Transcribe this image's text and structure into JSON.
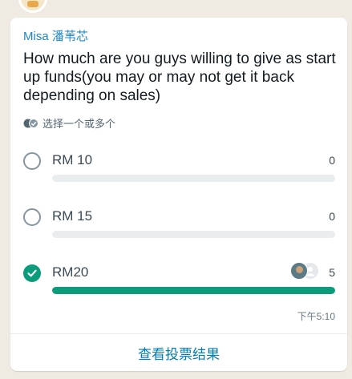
{
  "message": {
    "sender": "Misa 潘苇芯",
    "poll": {
      "question": "How much are you guys willing to give as start up funds(you may or may not get it back depending on sales)",
      "hint": "选择一个或多个",
      "options": [
        {
          "label": "RM 10",
          "votes": "0",
          "fraction": 0,
          "selected": false
        },
        {
          "label": "RM 15",
          "votes": "0",
          "fraction": 0,
          "selected": false
        },
        {
          "label": "RM20",
          "votes": "5",
          "fraction": 1,
          "selected": true
        }
      ]
    },
    "time": "下午5:10",
    "view_results_label": "查看投票结果"
  },
  "colors": {
    "accent": "#0a9c7b",
    "sender": "#1e88c8",
    "link": "#027eb5"
  },
  "icons": {
    "hint": "double-check-icon",
    "selected": "check-icon",
    "voter": "avatar-icon"
  }
}
